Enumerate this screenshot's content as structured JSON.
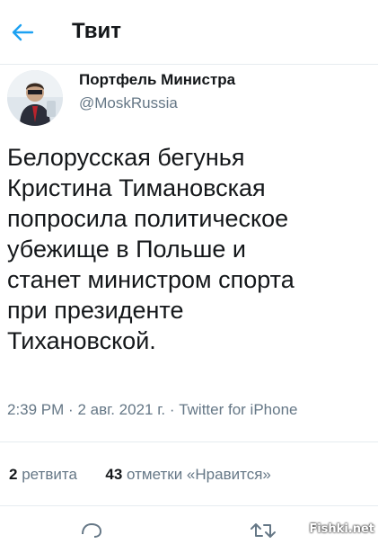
{
  "header": {
    "title": "Твит",
    "back_icon": "arrow-left-icon"
  },
  "author": {
    "name": "Портфель Министра",
    "handle": "@MoskRussia",
    "avatar_icon": "avatar-photo"
  },
  "tweet": {
    "text": "Белорусская бегунья\nКристина Тимановская\nпопросила политическое\nубежище в Польше и\nстанет министром спорта\nпри президенте\nТихановской.",
    "time": "2:39 PM",
    "date": "2 авг. 2021 г.",
    "source": "Twitter for iPhone"
  },
  "stats": {
    "retweets_count": "2",
    "retweets_label": "ретвита",
    "likes_count": "43",
    "likes_label": "отметки «Нравится»"
  },
  "actions": {
    "reply_icon": "reply-icon",
    "retweet_icon": "retweet-icon"
  },
  "watermark": "Fishki.net",
  "colors": {
    "accent": "#1da1f2",
    "text": "#14171a",
    "secondary": "#657786",
    "divider": "#e6ecf0"
  }
}
